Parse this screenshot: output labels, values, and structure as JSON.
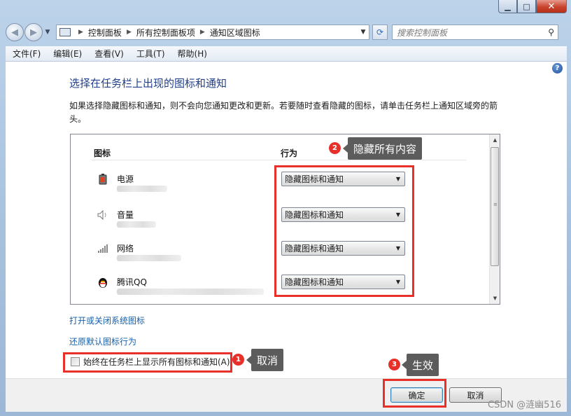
{
  "window": {
    "controls": {
      "minimize": "▁",
      "maximize": "□",
      "close": "✕"
    }
  },
  "navbar": {
    "back_icon": "back-arrow-icon",
    "forward_icon": "forward-arrow-icon",
    "breadcrumbs": [
      "控制面板",
      "所有控制面板项",
      "通知区域图标"
    ],
    "search_placeholder": "搜索控制面板"
  },
  "menu": [
    "文件(F)",
    "编辑(E)",
    "查看(V)",
    "工具(T)",
    "帮助(H)"
  ],
  "main": {
    "title": "选择在任务栏上出现的图标和通知",
    "description": "如果选择隐藏图标和通知，则不会向您通知更改和更新。若要随时查看隐藏的图标，请单击任务栏上通知区域旁的箭头。",
    "columns": {
      "icon": "图标",
      "behavior": "行为"
    },
    "rows": [
      {
        "name": "电源",
        "icon": "battery-icon",
        "behavior": "隐藏图标和通知"
      },
      {
        "name": "音量",
        "icon": "speaker-icon",
        "behavior": "隐藏图标和通知"
      },
      {
        "name": "网络",
        "icon": "network-signal-icon",
        "behavior": "隐藏图标和通知"
      },
      {
        "name": "腾讯QQ",
        "icon": "qq-penguin-icon",
        "behavior": "隐藏图标和通知"
      }
    ],
    "link_system_icons": "打开或关闭系统图标",
    "link_restore": "还原默认图标行为",
    "always_show_label": "始终在任务栏上显示所有图标和通知(A)",
    "always_show_checked": false
  },
  "footer": {
    "ok": "确定",
    "cancel": "取消",
    "watermark": "CSDN @涟幽516"
  },
  "annotations": [
    {
      "badge": "1",
      "text": "取消"
    },
    {
      "badge": "2",
      "text": "隐藏所有内容"
    },
    {
      "badge": "3",
      "text": "生效"
    }
  ],
  "colors": {
    "annotation_red": "#e8302a",
    "callout_bg": "#5c5c5c",
    "title_blue": "#1f3f8a",
    "link_blue": "#1660a8"
  }
}
